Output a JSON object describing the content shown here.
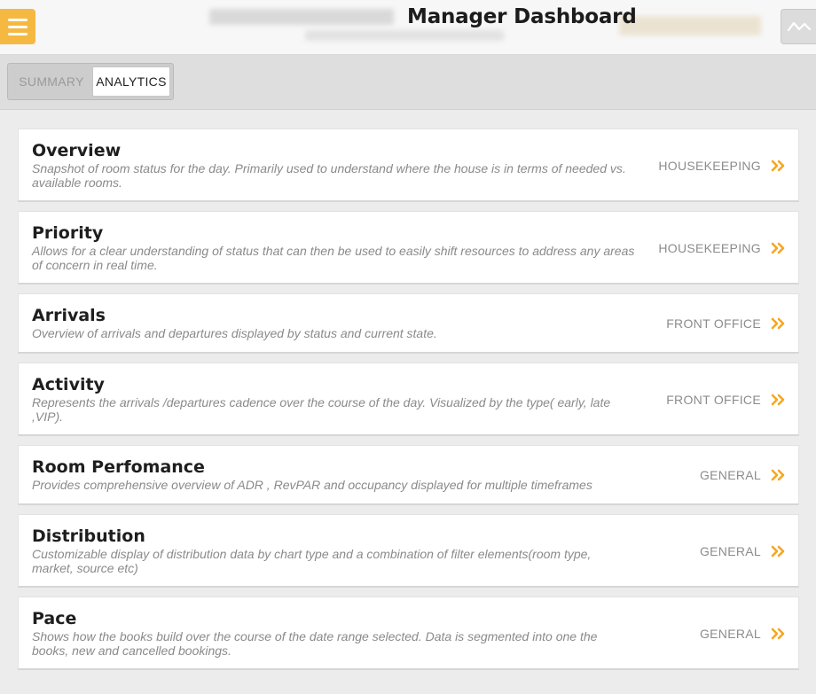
{
  "header": {
    "title": "Manager Dashboard",
    "menu_icon": "hamburger-menu-icon",
    "trend_icon": "trend-line-icon",
    "accent_color": "#f5b942"
  },
  "tabs": [
    {
      "label": "SUMMARY",
      "active": false
    },
    {
      "label": "ANALYTICS",
      "active": true
    }
  ],
  "cards": [
    {
      "title": "Overview",
      "description": "Snapshot of room status for the day. Primarily used to understand where the house is in terms of needed vs. available rooms.",
      "category": "HOUSEKEEPING"
    },
    {
      "title": "Priority",
      "description": "Allows for a clear understanding of status that can then be used to easily shift resources to address any areas of concern in real time.",
      "category": "HOUSEKEEPING"
    },
    {
      "title": "Arrivals",
      "description": "Overview of arrivals and departures displayed by status and current state.",
      "category": "FRONT OFFICE"
    },
    {
      "title": "Activity",
      "description": "Represents the arrivals /departures cadence over the course of the day. Visualized by the type( early, late ,VIP).",
      "category": "FRONT OFFICE"
    },
    {
      "title": "Room Perfomance",
      "description": "Provides comprehensive overview of ADR , RevPAR and occupancy displayed for multiple timeframes",
      "category": "GENERAL"
    },
    {
      "title": "Distribution",
      "description": "Customizable display of distribution data by chart type and a combination of filter elements(room type, market, source etc)",
      "category": "GENERAL"
    },
    {
      "title": "Pace",
      "description": "Shows how the books build over the course of the date range selected. Data is segmented into one the books, new and cancelled bookings.",
      "category": "GENERAL"
    }
  ],
  "chevron_icon": "double-chevron-right-icon",
  "chevron_color": "#f5a623"
}
